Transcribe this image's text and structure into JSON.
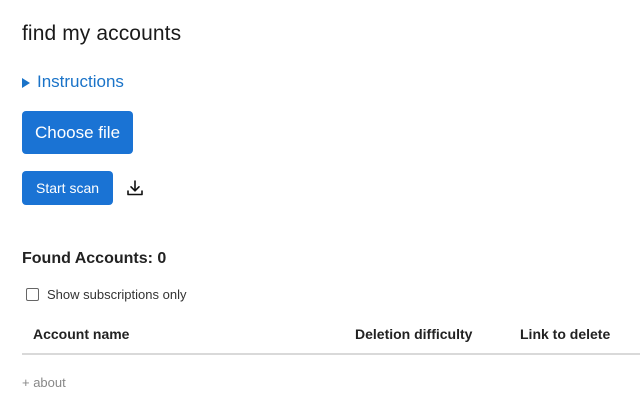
{
  "header": {
    "title": "find my accounts"
  },
  "instructions": {
    "label": "Instructions",
    "expanded": false
  },
  "buttons": {
    "choose_file": "Choose file",
    "start_scan": "Start scan",
    "download_icon": "download-icon"
  },
  "results": {
    "found_label": "Found Accounts: 0",
    "show_subscriptions_label": "Show subscriptions only",
    "show_subscriptions_checked": false
  },
  "table": {
    "columns": [
      "Account name",
      "Deletion difficulty",
      "Link to delete"
    ],
    "rows": []
  },
  "footer": {
    "about_label": "+ about"
  },
  "colors": {
    "accent": "#1a73d4",
    "link": "#1a73c8"
  }
}
